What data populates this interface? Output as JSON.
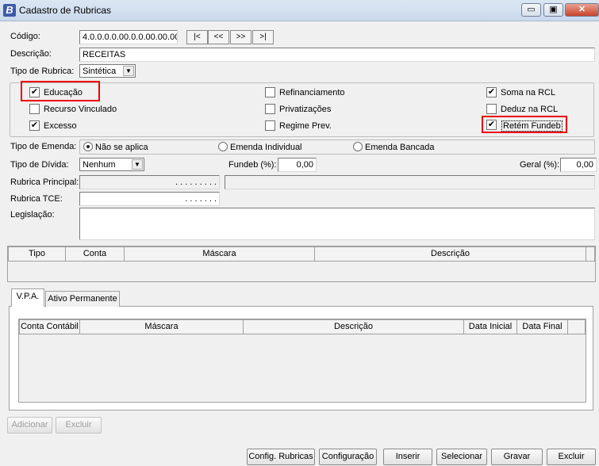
{
  "window": {
    "title": "Cadastro de Rubricas",
    "app_icon": "B",
    "minimize": "▭",
    "maximize": "▣",
    "close": "✕"
  },
  "codigo": {
    "label": "Código:",
    "value": "4.0.0.0.0.00.0.0.00.00.00"
  },
  "nav": {
    "first": "|<",
    "prev": "<<",
    "next": ">>",
    "last": ">|"
  },
  "descricao": {
    "label": "Descrição:",
    "value": "RECEITAS"
  },
  "tipo_rubrica": {
    "label": "Tipo de Rubrica:",
    "value": "Sintética"
  },
  "checks": {
    "educacao": {
      "label": "Educação",
      "checked": true
    },
    "recurso_vinculado": {
      "label": "Recurso Vinculado",
      "checked": false
    },
    "excesso": {
      "label": "Excesso",
      "checked": true
    },
    "refinanciamento": {
      "label": "Refinanciamento",
      "checked": false
    },
    "privatizacoes": {
      "label": "Privatizações",
      "checked": false
    },
    "regime_prev": {
      "label": "Regime Prev.",
      "checked": false
    },
    "soma_rcl": {
      "label": "Soma na RCL",
      "checked": true
    },
    "deduz_rcl": {
      "label": "Deduz na RCL",
      "checked": false
    },
    "retem_fundeb": {
      "label": "Retém Fundeb",
      "checked": true
    }
  },
  "tipo_emenda": {
    "label": "Tipo de Emenda:",
    "options": [
      "Não se aplica",
      "Emenda Individual",
      "Emenda Bancada"
    ],
    "selected": "Não se aplica"
  },
  "tipo_divida": {
    "label": "Tipo de Dívida:",
    "value": "Nenhum"
  },
  "fundeb": {
    "label": "Fundeb (%):",
    "value": "0,00"
  },
  "geral": {
    "label": "Geral (%):",
    "value": "0,00"
  },
  "rubrica_principal": {
    "label": "Rubrica Principal:",
    "value": ". . . . . . . . ."
  },
  "rubrica_tce": {
    "label": "Rubrica TCE:",
    "value": ". . . . . . ."
  },
  "legislacao": {
    "label": "Legislação:",
    "value": ""
  },
  "grid1": {
    "columns": [
      "Tipo",
      "Conta",
      "Máscara",
      "Descrição"
    ]
  },
  "tabs": [
    "V.P.A.",
    "Ativo Permanente"
  ],
  "grid2": {
    "columns": [
      "Conta Contábil",
      "Máscara",
      "Descrição",
      "Data Inicial",
      "Data Final"
    ]
  },
  "actions": {
    "adicionar": "Adicionar",
    "excluir": "Excluir"
  },
  "footer": {
    "config_rubricas": "Config. Rubricas",
    "configuracao": "Configuração",
    "inserir": "Inserir",
    "selecionar": "Selecionar",
    "gravar": "Gravar",
    "excluir": "Excluir"
  },
  "colors": {
    "highlight_border": "#e00000"
  }
}
